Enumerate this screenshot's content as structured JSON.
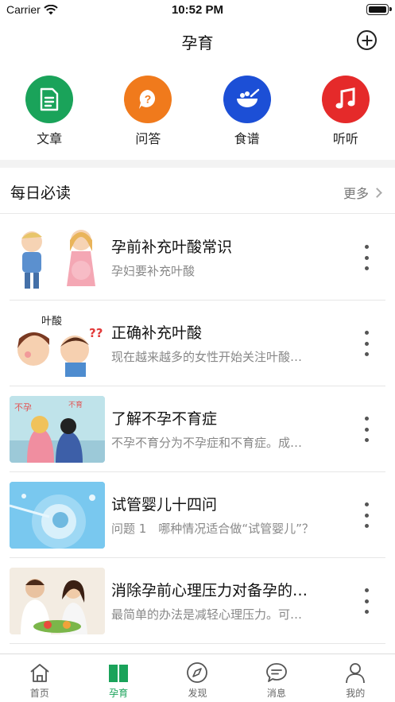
{
  "status_bar": {
    "carrier": "Carrier",
    "time": "10:52 PM"
  },
  "nav": {
    "title": "孕育"
  },
  "quick_actions": [
    {
      "label": "文章",
      "icon": "document-icon",
      "color": "#1aa35a"
    },
    {
      "label": "问答",
      "icon": "question-bubble-icon",
      "color": "#f07a1c"
    },
    {
      "label": "食谱",
      "icon": "bowl-icon",
      "color": "#1c4fd6"
    },
    {
      "label": "听听",
      "icon": "music-note-icon",
      "color": "#e52a2a"
    }
  ],
  "section": {
    "title": "每日必读",
    "more": "更多"
  },
  "articles": [
    {
      "title": "孕前补充叶酸常识",
      "subtitle": "孕妇要补充叶酸"
    },
    {
      "title": "正确补充叶酸",
      "subtitle": "现在越来越多的女性开始关注叶酸…",
      "thumb_text": "叶酸"
    },
    {
      "title": "了解不孕不育症",
      "subtitle": "不孕不育分为不孕症和不育症。成…",
      "thumb_text_1": "不孕",
      "thumb_text_2": "不育"
    },
    {
      "title": "试管婴儿十四问",
      "subtitle": "问题 1　哪种情况适合做“试管婴儿”？"
    },
    {
      "title": "消除孕前心理压力对备孕的…",
      "subtitle": "最简单的办法是减轻心理压力。可…"
    }
  ],
  "tabs": [
    {
      "label": "首页",
      "icon": "home-icon",
      "active": false
    },
    {
      "label": "孕育",
      "icon": "book-icon",
      "active": true
    },
    {
      "label": "发现",
      "icon": "compass-icon",
      "active": false
    },
    {
      "label": "消息",
      "icon": "message-icon",
      "active": false
    },
    {
      "label": "我的",
      "icon": "user-icon",
      "active": false
    }
  ],
  "colors": {
    "accent": "#1aa35a",
    "text": "#111111",
    "muted": "#888888"
  }
}
